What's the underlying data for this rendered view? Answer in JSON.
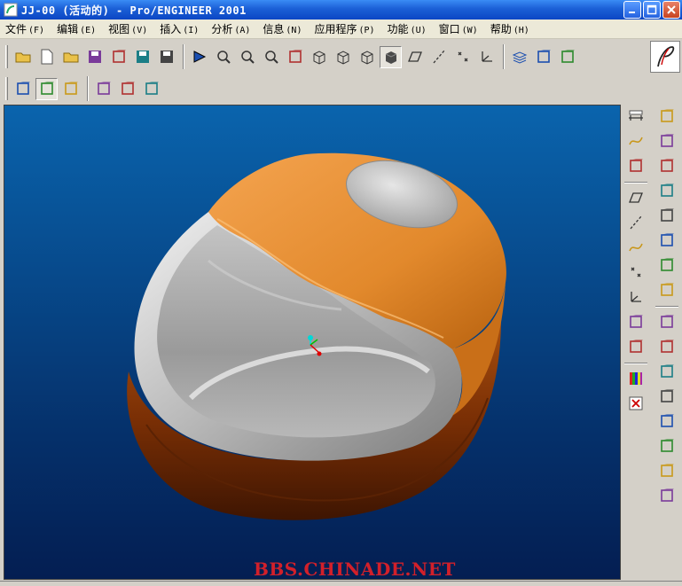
{
  "window": {
    "title": "JJ-00 (活动的) - Pro/ENGINEER 2001",
    "controls": [
      "minimize",
      "maximize",
      "close"
    ]
  },
  "menu": [
    {
      "label": "文件",
      "accel": "(F)"
    },
    {
      "label": "编辑",
      "accel": "(E)"
    },
    {
      "label": "视图",
      "accel": "(V)"
    },
    {
      "label": "插入",
      "accel": "(I)"
    },
    {
      "label": "分析",
      "accel": "(A)"
    },
    {
      "label": "信息",
      "accel": "(N)"
    },
    {
      "label": "应用程序",
      "accel": "(P)"
    },
    {
      "label": "功能",
      "accel": "(U)"
    },
    {
      "label": "窗口",
      "accel": "(W)"
    },
    {
      "label": "帮助",
      "accel": "(H)"
    }
  ],
  "toolbar_main": [
    "new-folder-icon",
    "new-file-icon",
    "open-icon",
    "save-as-window-icon",
    "edit-icon",
    "save-icon",
    "save-copy-icon",
    "repaint-icon",
    "zoom-window-icon",
    "zoom-in-icon",
    "zoom-out-icon",
    "named-view-icon",
    "wireframe-icon",
    "hidden-line-icon",
    "no-hidden-icon",
    "shaded-icon",
    "datum-plane-display-icon",
    "datum-axis-display-icon",
    "datum-point-display-icon",
    "csys-display-icon",
    "layers-icon",
    "model-tree-icon",
    "windows-icon"
  ],
  "toolbar_secondary": [
    "spin-center-icon",
    "orient-mode-icon",
    "query-select-icon",
    "feature-icon",
    "sketch-icon",
    "group-icon"
  ],
  "right_toolbar_datum": [
    "measure-icon",
    "sketched-curve-icon",
    "sketch-tool-icon",
    "datum-plane-icon",
    "datum-axis-icon",
    "datum-curve-icon",
    "datum-point-icon",
    "csys-icon",
    "analysis-icon",
    "offset-icon",
    "color-appearance-icon",
    "close-window-icon"
  ],
  "right_toolbar_features": [
    "extrude-icon",
    "rib-icon",
    "revolve-icon",
    "draft-icon",
    "round-icon",
    "shell-icon",
    "hole-icon",
    "chamfer-icon",
    "protrusion-icon",
    "cut-icon",
    "blend-icon",
    "sweep-icon",
    "swept-blend-icon",
    "variable-section-sweep-icon",
    "copy-icon",
    "pattern-icon"
  ],
  "viewport": {
    "watermark": "BBS.CHINADE.NET",
    "colors": {
      "bg_top": "#0a64ad",
      "bg_bottom": "#041e52",
      "body": "#8a3a06",
      "top_cap": "#e18a2a",
      "rim": "#d9d9d9",
      "inner": "#a8a8a8",
      "watermark": "#d2202a"
    }
  },
  "logo": "PTC"
}
